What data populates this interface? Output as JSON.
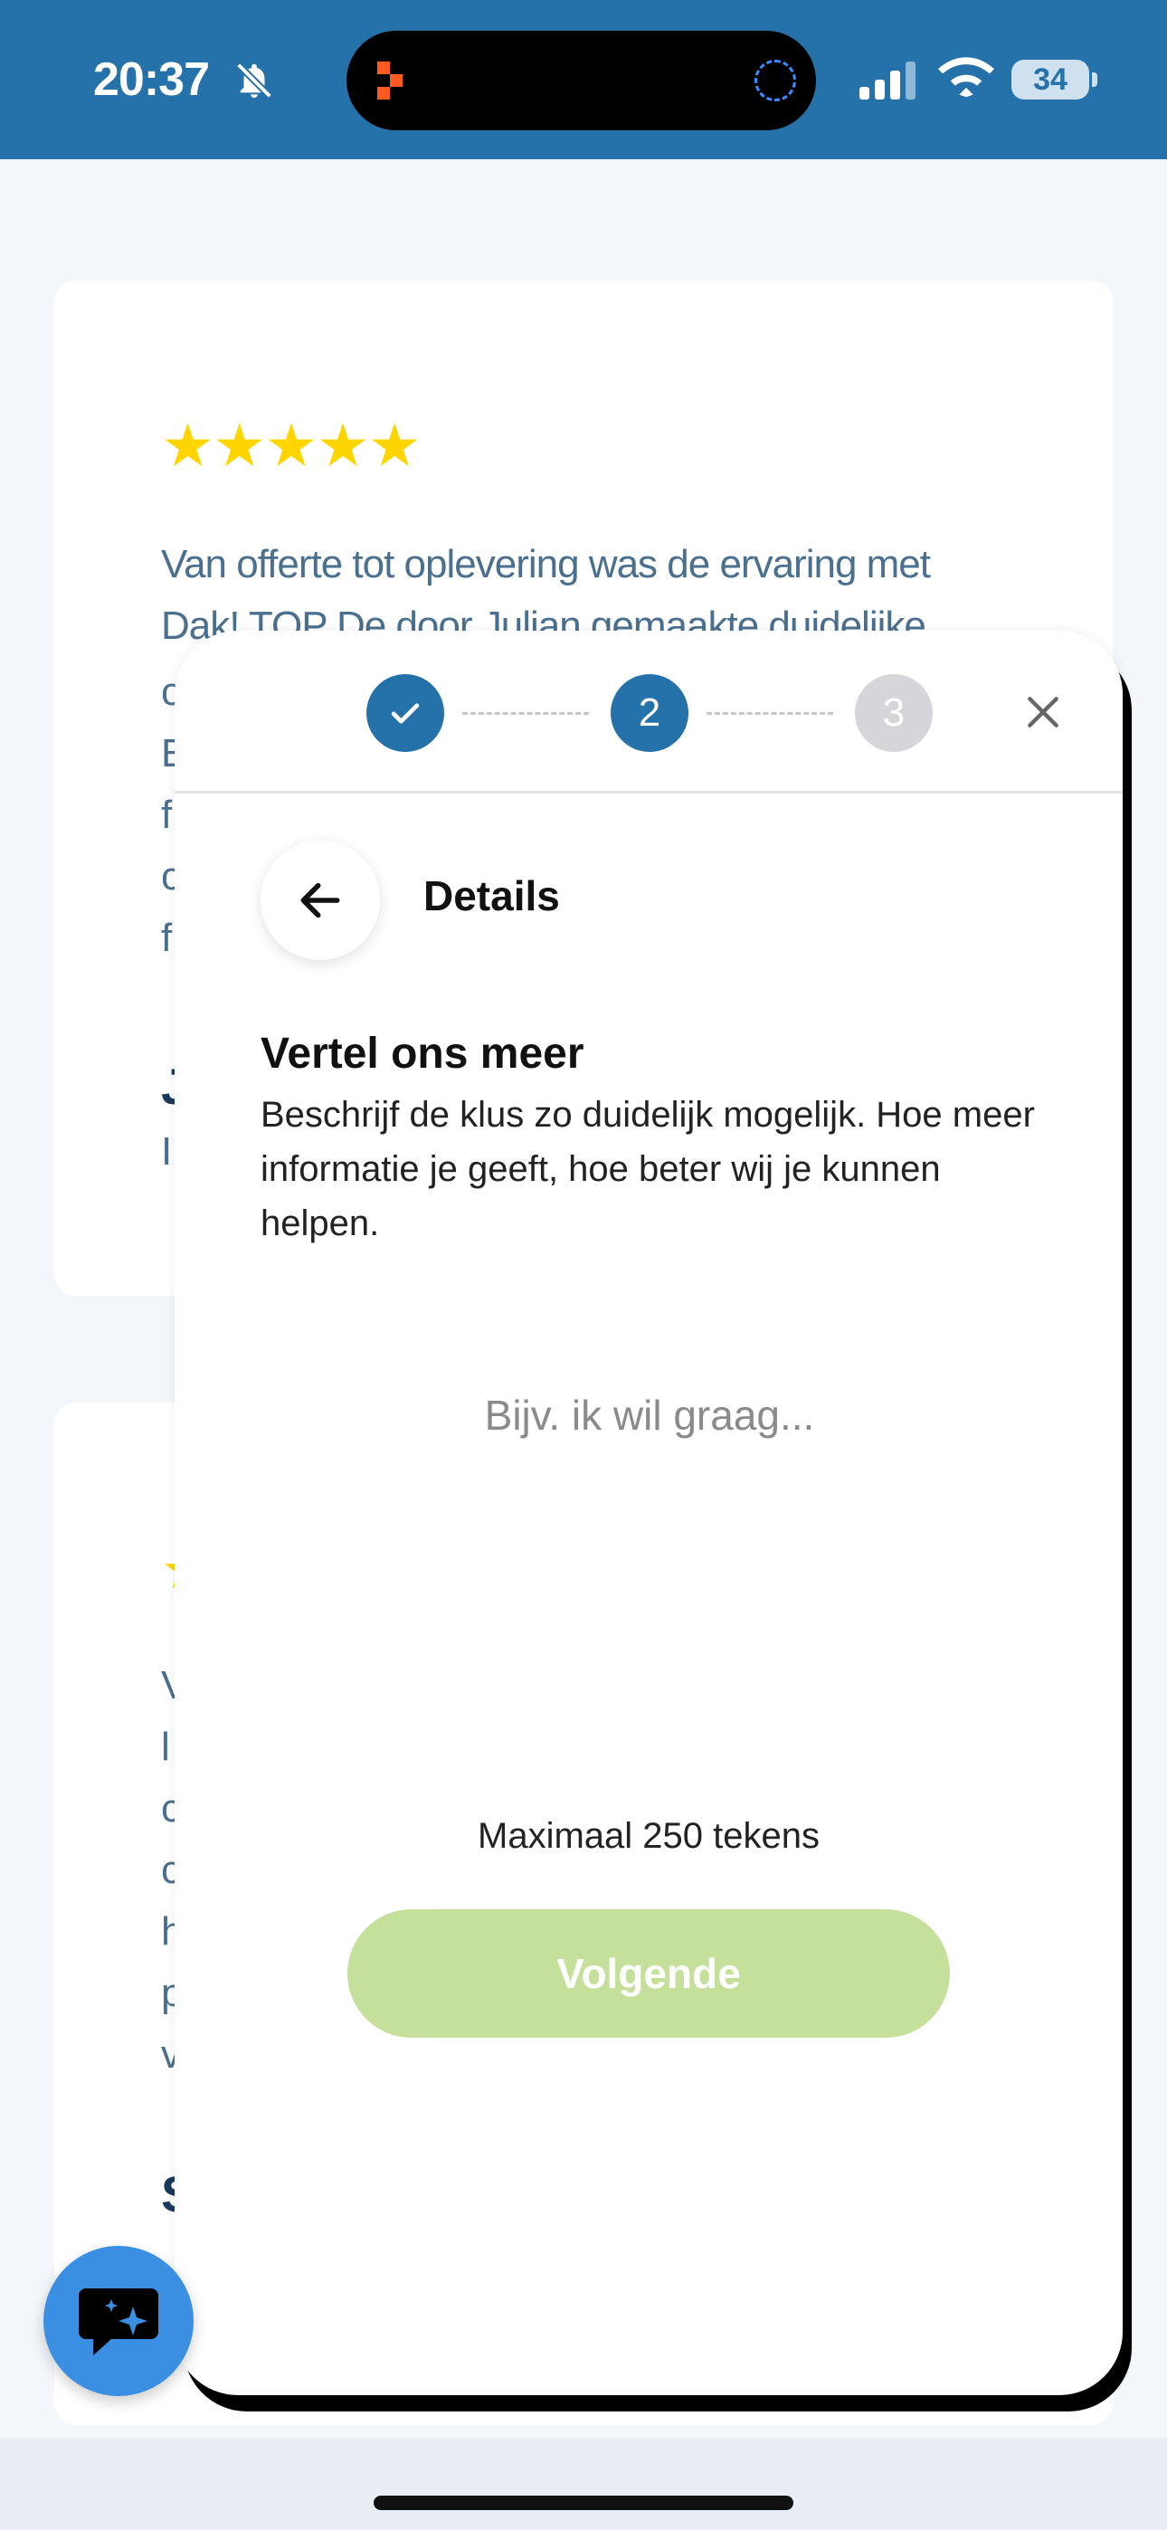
{
  "status_bar": {
    "time": "20:37",
    "battery": "34",
    "icons": [
      "bell-slash-icon",
      "signal-icon",
      "wifi-icon",
      "battery-icon"
    ]
  },
  "background_reviews": {
    "stars": "★★★★★",
    "review1_lines": [
      "Van offerte tot oplevering was de ervaring met",
      "Dak! TOP De door Julian gemaakte duidelijke"
    ],
    "peek_letters_card1": [
      "c",
      "E",
      "f",
      "c",
      "f"
    ],
    "peek_bold_card1": "J",
    "peek_name_card1": "I",
    "peek_letters_card2": [
      "V",
      "l",
      "c",
      "c",
      "h",
      "p",
      "v"
    ],
    "peek_bold_card2": "S"
  },
  "modal": {
    "steps": [
      {
        "label": "✓",
        "state": "done"
      },
      {
        "label": "2",
        "state": "active"
      },
      {
        "label": "3",
        "state": "pending"
      }
    ],
    "header_title": "Details",
    "question_title": "Vertel ons meer",
    "question_description": "Beschrijf de klus zo duidelijk mogelijk. Hoe meer informatie je geeft, hoe beter wij je kunnen helpen.",
    "textarea_placeholder": "Bijv. ik wil graag...",
    "textarea_value": "",
    "char_limit_text": "Maximaal 250 tekens",
    "next_button": "Volgende"
  },
  "colors": {
    "primary": "#2571a9",
    "next_button_disabled": "#c5e09a",
    "step_pending": "#d4d6d9",
    "star": "#ffd500",
    "chat_fab": "#3b8fe3"
  }
}
